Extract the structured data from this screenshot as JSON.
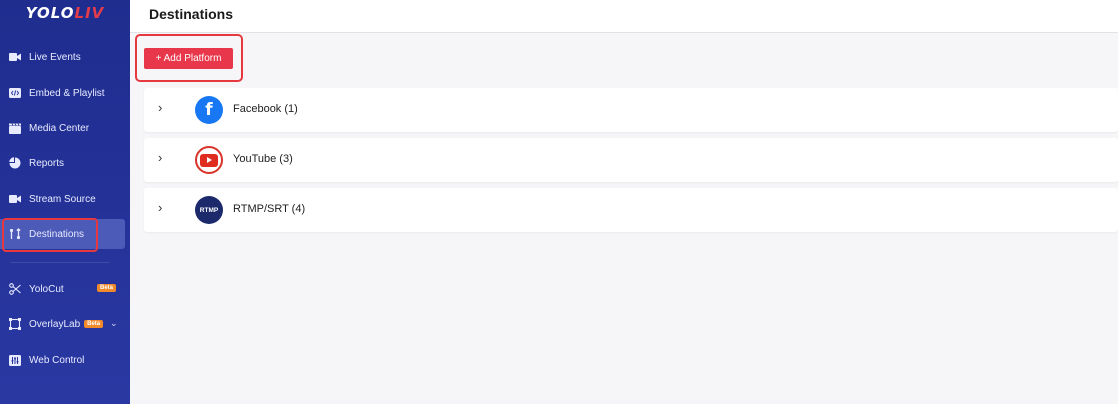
{
  "brand": {
    "logo_prefix": "YOLO",
    "logo_suffix": "LIV"
  },
  "header": {
    "title": "Destinations"
  },
  "sidebar": {
    "items": [
      {
        "label": "Live Events",
        "icon": "camera-icon"
      },
      {
        "label": "Embed & Playlist",
        "icon": "code-icon"
      },
      {
        "label": "Media Center",
        "icon": "clapper-icon"
      },
      {
        "label": "Reports",
        "icon": "pie-chart-icon"
      },
      {
        "label": "Stream Source",
        "icon": "camera-icon"
      },
      {
        "label": "Destinations",
        "icon": "route-icon",
        "active": true
      },
      {
        "label": "YoloCut",
        "icon": "scissors-icon",
        "badge": "Beta"
      },
      {
        "label": "OverlayLab",
        "icon": "frame-icon",
        "badge": "Beta"
      },
      {
        "label": "Web Control",
        "icon": "sliders-icon"
      }
    ]
  },
  "toolbar": {
    "add_label": "+ Add Platform"
  },
  "platforms": [
    {
      "name": "Facebook (1)",
      "icon": "facebook-icon",
      "icon_text": "f"
    },
    {
      "name": "YouTube (3)",
      "icon": "youtube-icon"
    },
    {
      "name": "RTMP/SRT (4)",
      "icon": "rtmp-icon",
      "icon_text": "RTMP"
    }
  ],
  "colors": {
    "sidebar": "#25339a",
    "accent": "#e8364a",
    "active_item": "#4c5ab8",
    "facebook": "#1877f2",
    "youtube": "#e02b20",
    "rtmp": "#1c2a6b"
  }
}
